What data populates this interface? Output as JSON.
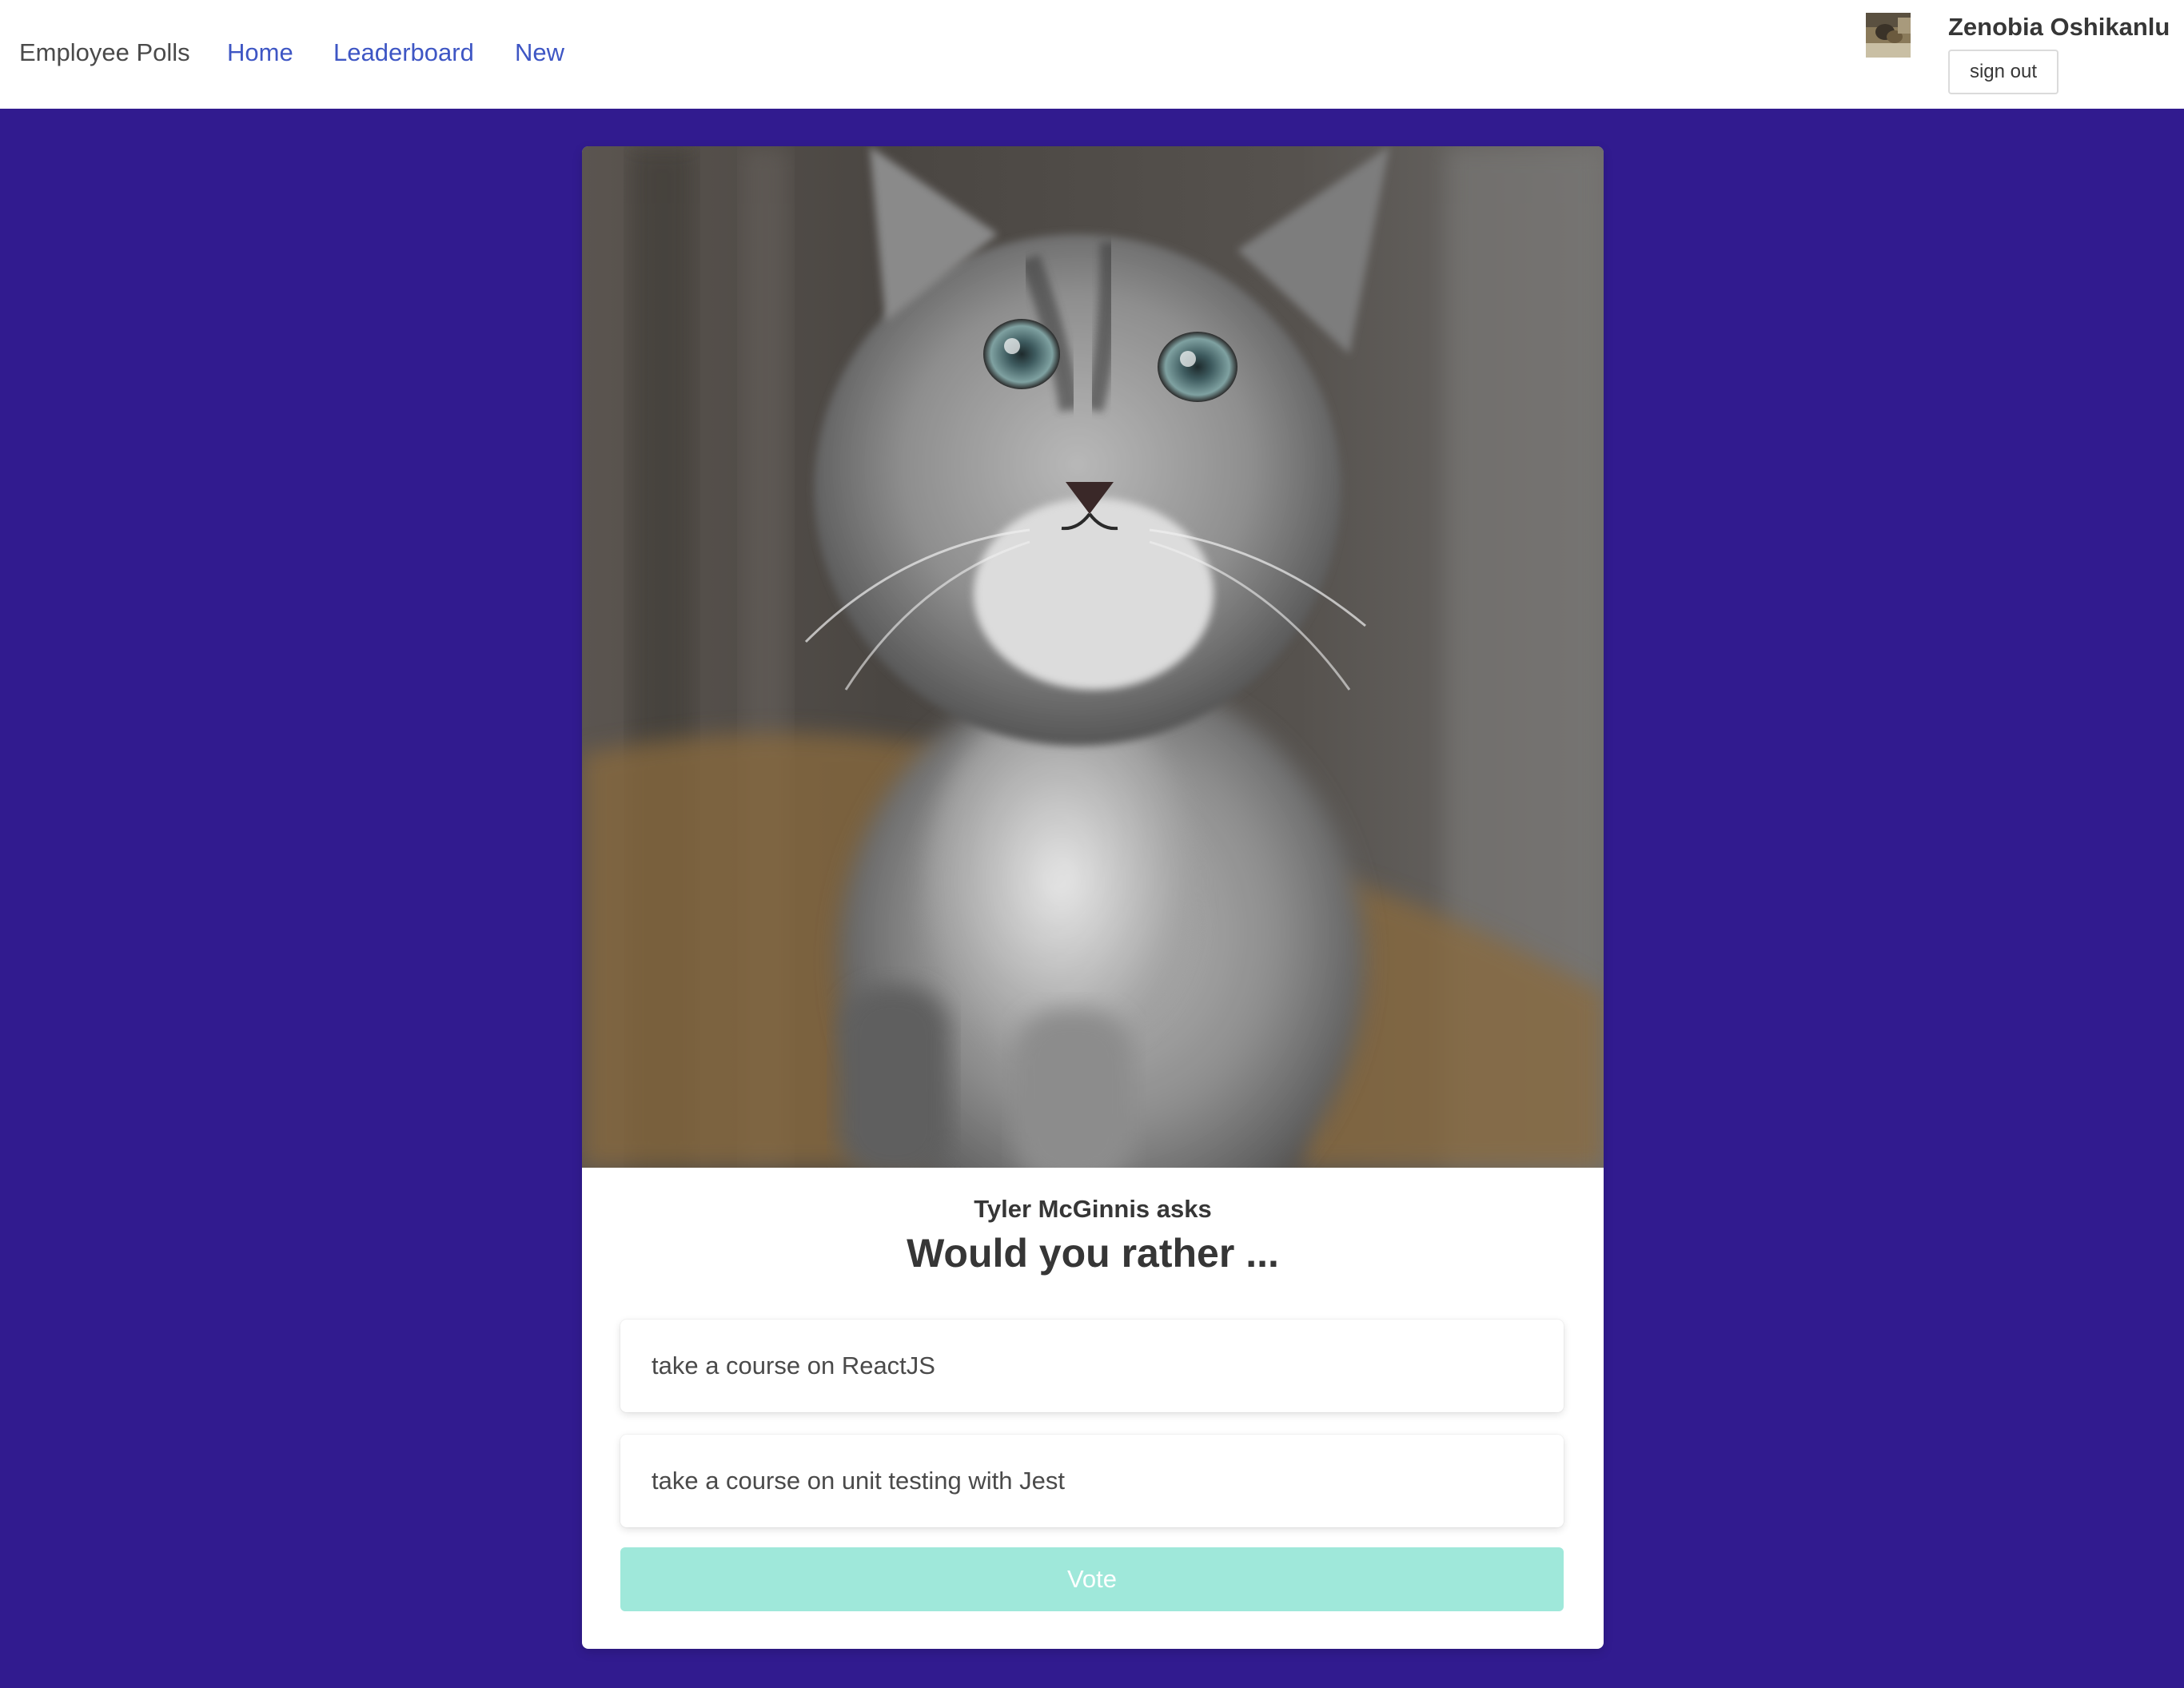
{
  "navbar": {
    "brand": "Employee Polls",
    "links": [
      "Home",
      "Leaderboard",
      "New"
    ]
  },
  "user": {
    "name": "Zenobia Oshikanlu",
    "avatar_icon": "user-avatar-photo",
    "signout_label": "sign out"
  },
  "poll": {
    "image_icon": "kitten-photo",
    "asker": "Tyler McGinnis asks",
    "title": "Would you rather ...",
    "options": [
      "take a course on ReactJS",
      "take a course on unit testing with Jest"
    ],
    "vote_label": "Vote"
  },
  "colors": {
    "page_background": "#311b8f",
    "nav_link": "#3e56c4",
    "vote_button": "#9fe8da"
  }
}
